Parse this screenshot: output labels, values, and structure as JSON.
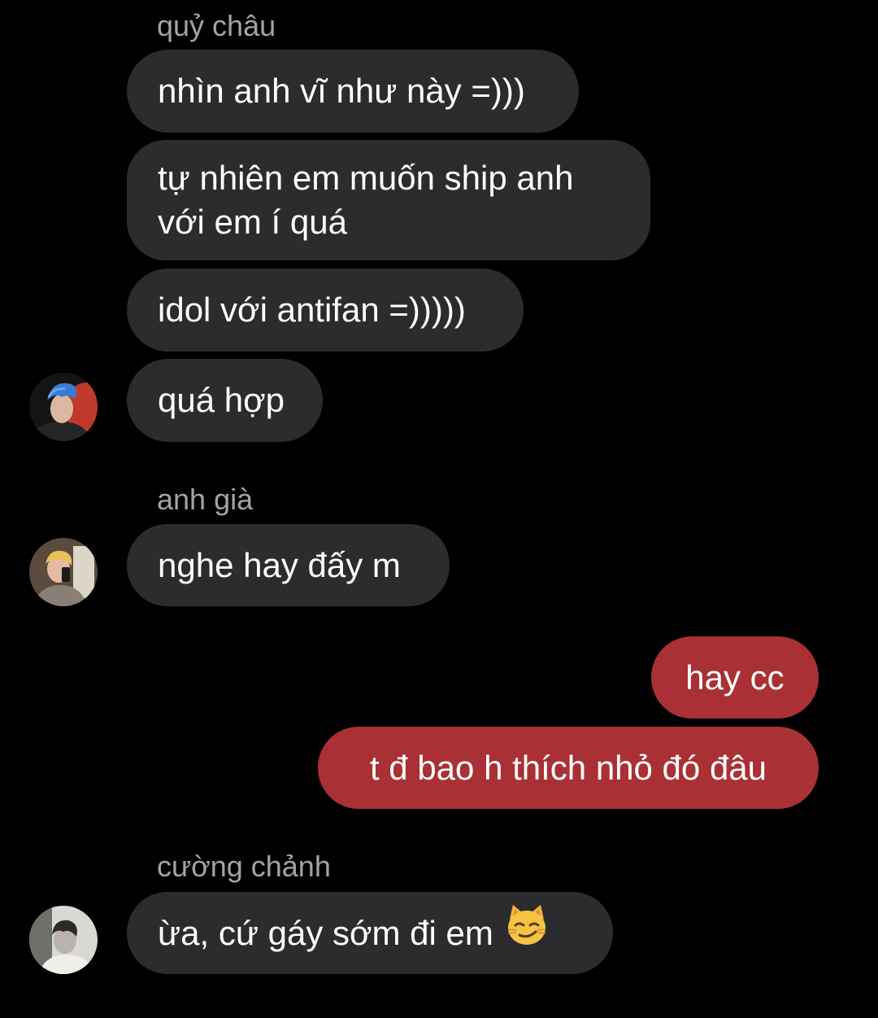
{
  "colors": {
    "background": "#000000",
    "incoming_bubble": "#2c2c2e",
    "outgoing_bubble": "#a93034",
    "sender_name": "#a3a3a3",
    "text": "#ffffff"
  },
  "groups": [
    {
      "sender": "quỷ châu",
      "avatar": "blue-haired-profile-avatar",
      "messages": [
        "nhìn anh vĩ như này =)))",
        [
          "tự nhiên em muốn ship anh",
          "với em í quá"
        ],
        "idol với antifan =)))))",
        "quá hợp"
      ]
    },
    {
      "sender": "anh già",
      "avatar": "mirror-selfie-avatar",
      "messages": [
        "nghe hay đấy m"
      ]
    },
    {
      "sender": "",
      "outgoing": true,
      "messages": [
        "hay cc",
        "t đ bao h thích nhỏ đó đâu"
      ]
    },
    {
      "sender": "cường chảnh",
      "avatar": "monochrome-portrait-avatar",
      "messages": [
        "ừa, cứ gáy sớm đi em"
      ],
      "emoji": "smirking-cat-emoji"
    }
  ]
}
